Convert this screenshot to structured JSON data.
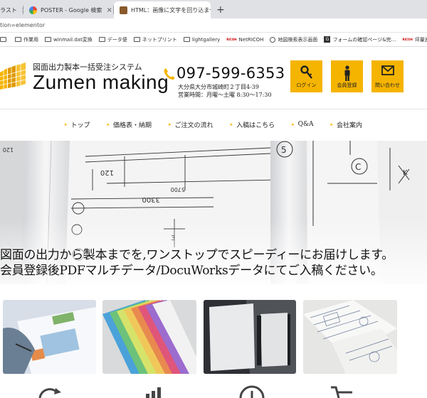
{
  "browser": {
    "tabs": [
      {
        "title": "ラスト",
        "close": "×"
      },
      {
        "title": "POSTER - Google 検索",
        "close": "×"
      },
      {
        "title": "HTML：画像に文字を回り込ませ…",
        "close": "×"
      }
    ],
    "new_tab": "+",
    "url": "tion=elementor",
    "bookmarks": [
      {
        "icon": "folder-icon",
        "label": ""
      },
      {
        "icon": "folder-icon",
        "label": "作業用"
      },
      {
        "icon": "folder-icon",
        "label": "winmail.dat変換"
      },
      {
        "icon": "folder-icon",
        "label": "データ便"
      },
      {
        "icon": "folder-icon",
        "label": "ネットプリント"
      },
      {
        "icon": "folder-icon",
        "label": "lightgallery"
      },
      {
        "icon": "ricoh-icon",
        "label": "NetRICOH"
      },
      {
        "icon": "globe-icon",
        "label": "地図検索表示画面"
      },
      {
        "icon": "form-icon",
        "label": "フォームの確認ページ&完…"
      },
      {
        "icon": "ricoh-icon",
        "label": "坪量連量変換ツール（R…"
      }
    ]
  },
  "header": {
    "tagline": "図面出力製本一括受注システム",
    "brand": "Zumen making",
    "phone": "097-599-6353",
    "address": "大分県大分市城崎町２丁目4-39",
    "hours": "営業時間：月曜～土曜 8:30～17:30",
    "buttons": [
      {
        "label": "ログイン",
        "icon": "key-icon"
      },
      {
        "label": "会員登録",
        "icon": "person-icon"
      },
      {
        "label": "問い合わせ",
        "icon": "mail-icon"
      }
    ],
    "accent": "#f5b400"
  },
  "nav": [
    {
      "label": "トップ"
    },
    {
      "label": "価格表・納期"
    },
    {
      "label": "ご注文の流れ"
    },
    {
      "label": "入稿はこちら"
    },
    {
      "label": "Q&A"
    },
    {
      "label": "会社案内"
    }
  ],
  "hero": {
    "line1": "図面の出力から製本までを,ワンストップでスピーディーにお届けします。",
    "line2": "会員登録後PDFマルチデータ/DocuWorksデータにてご入稿ください。",
    "drawing_labels": [
      "120",
      "3300",
      "5700",
      "5",
      "C",
      "K",
      "3"
    ]
  }
}
